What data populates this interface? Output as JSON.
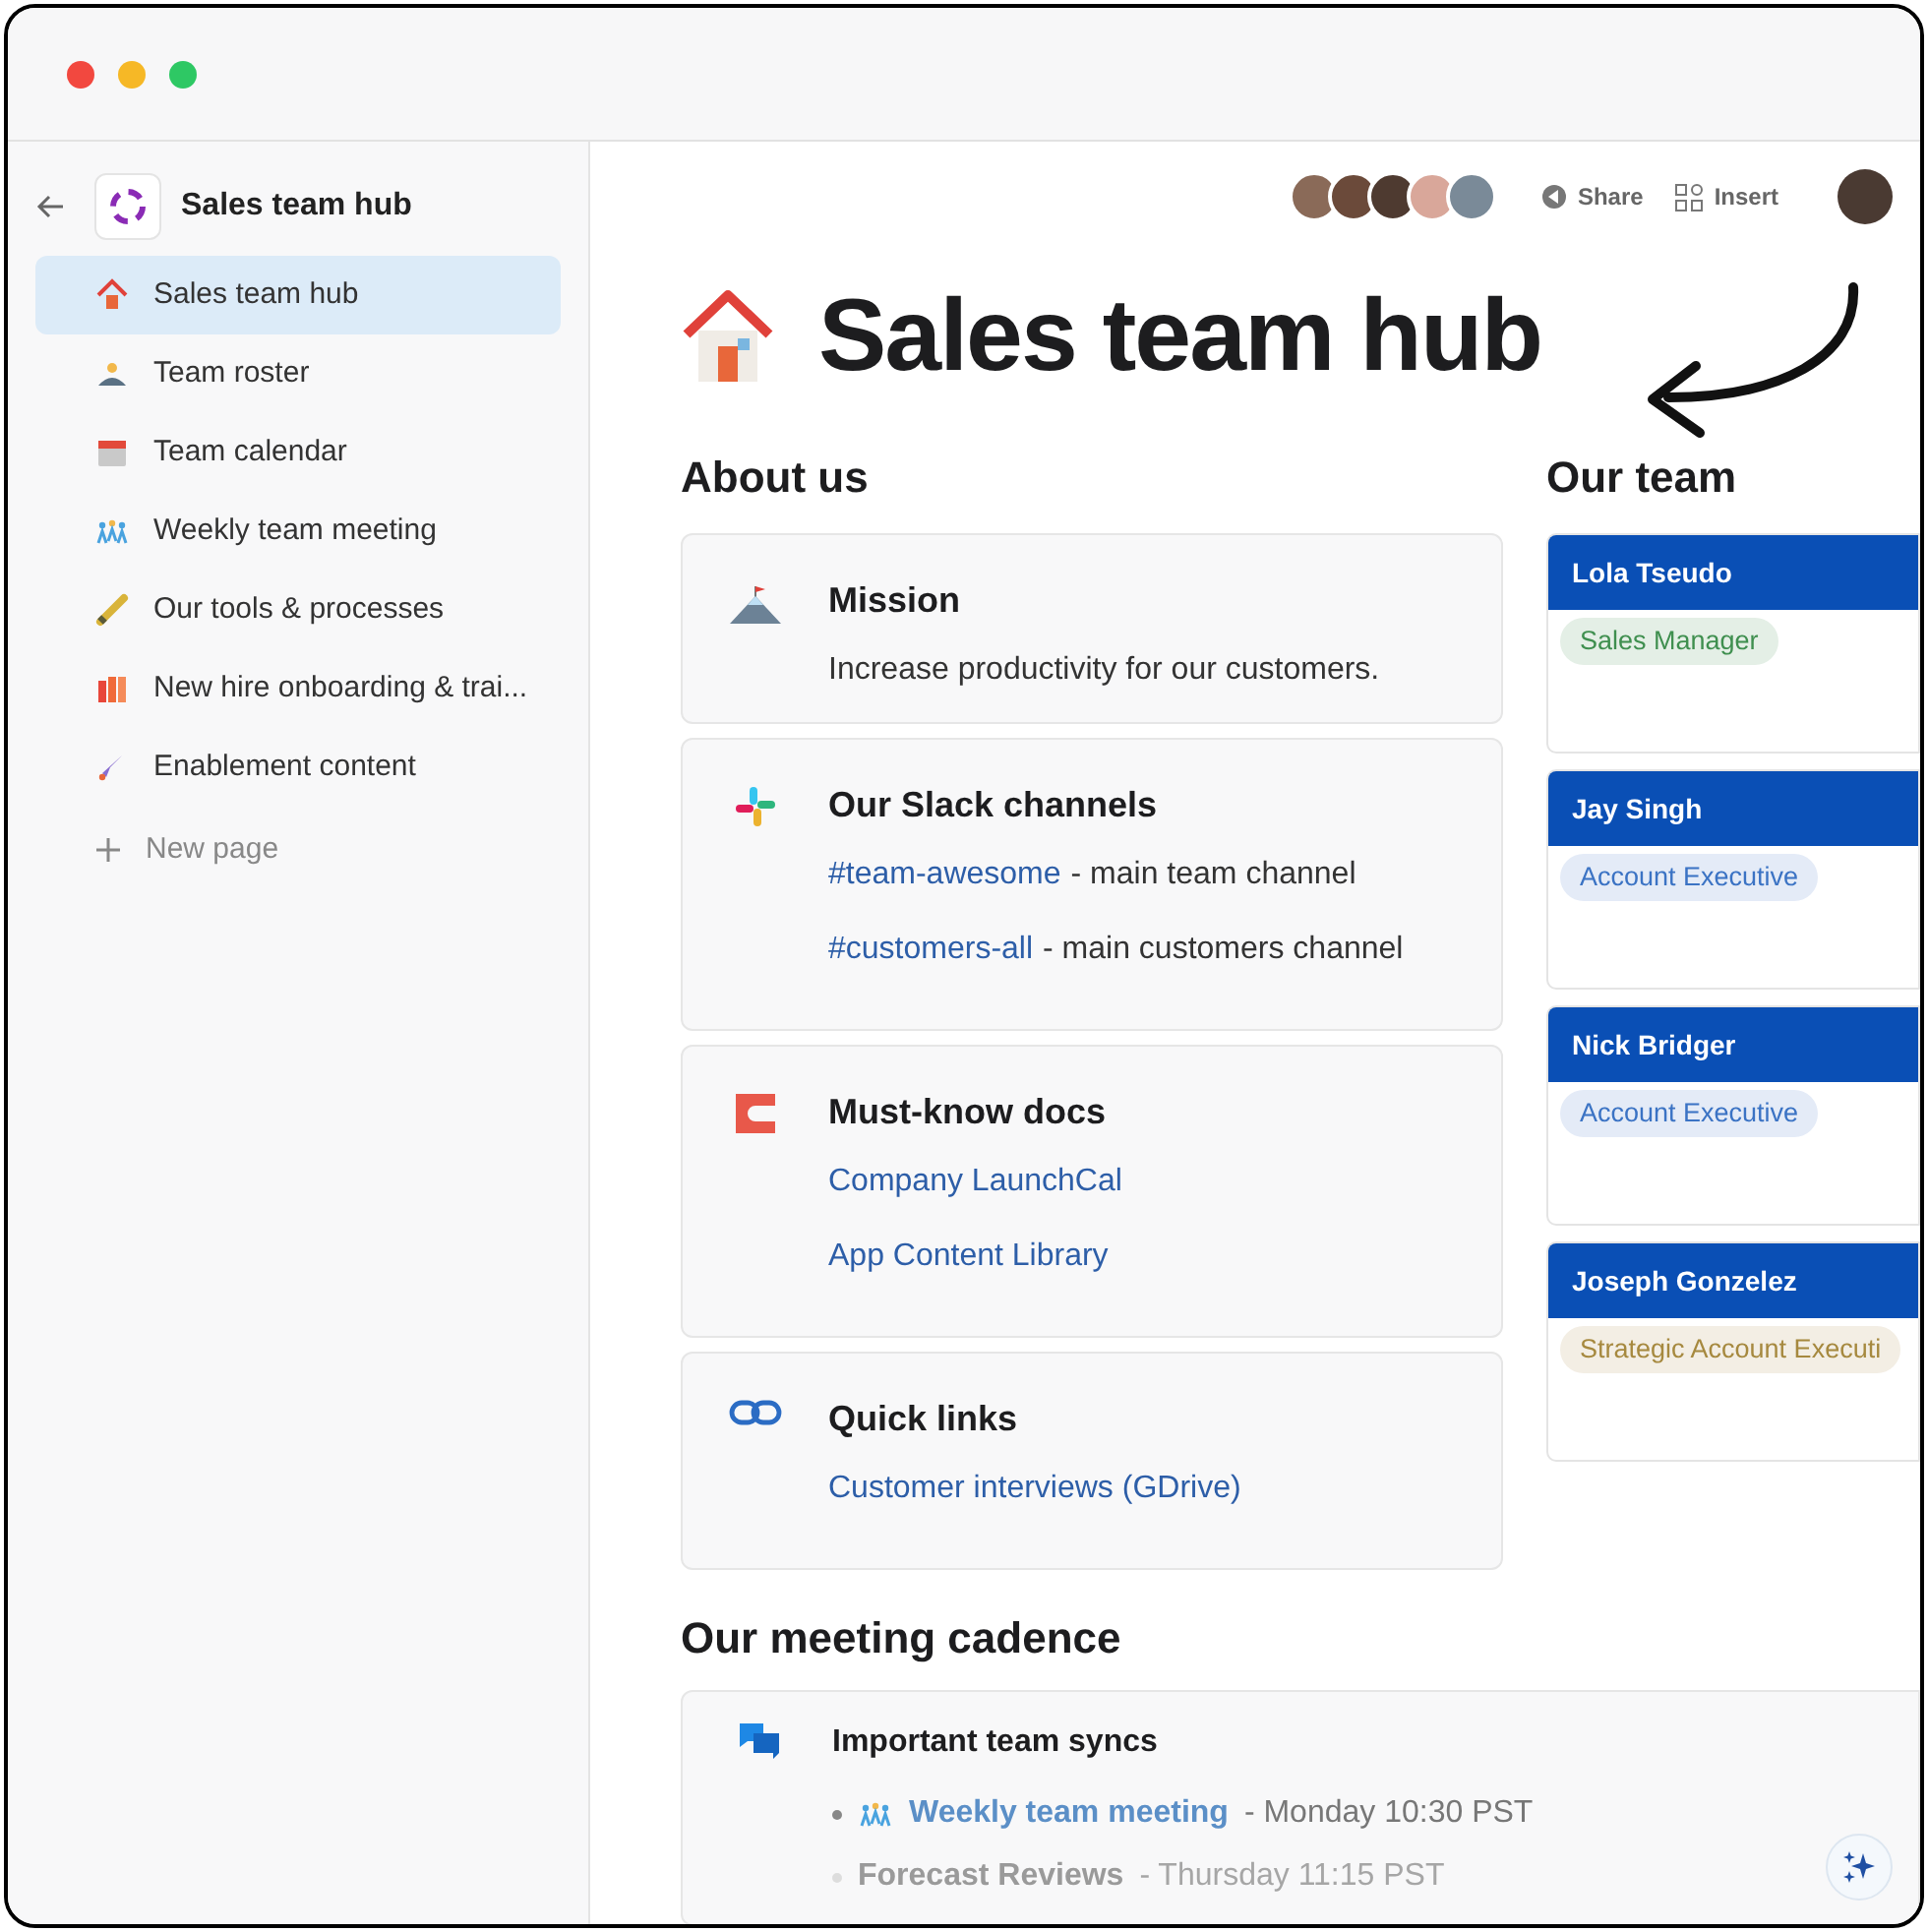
{
  "sidebar": {
    "title": "Sales team hub",
    "items": [
      {
        "label": "Sales team hub",
        "selected": true
      },
      {
        "label": "Team roster",
        "selected": false
      },
      {
        "label": "Team calendar",
        "selected": false
      },
      {
        "label": "Weekly team meeting",
        "selected": false
      },
      {
        "label": "Our tools & processes",
        "selected": false
      },
      {
        "label": "New hire onboarding & trai...",
        "selected": false
      },
      {
        "label": "Enablement content",
        "selected": false
      }
    ],
    "new_page": "New page"
  },
  "toolbar": {
    "share": "Share",
    "insert": "Insert"
  },
  "page": {
    "title": "Sales team hub",
    "about_heading": "About us",
    "cards": [
      {
        "kind": "text",
        "title": "Mission",
        "body": "Increase productivity for our customers."
      },
      {
        "kind": "links",
        "title": "Our Slack channels",
        "links": [
          {
            "link": "#team-awesome",
            "note": "- main team channel"
          },
          {
            "link": "#customers-all",
            "note": "- main customers channel"
          }
        ]
      },
      {
        "kind": "links",
        "title": "Must-know docs",
        "links": [
          {
            "link": "Company LaunchCal"
          },
          {
            "link": "App Content Library"
          }
        ]
      },
      {
        "kind": "links",
        "title": "Quick links",
        "links": [
          {
            "link": "Customer interviews (GDrive)"
          }
        ]
      }
    ],
    "team_heading": "Our team",
    "team": [
      {
        "name": "Lola Tseudo",
        "role": "Sales Manager",
        "color": "#3f8f4f"
      },
      {
        "name": "Jay Singh",
        "role": "Account Executive",
        "color": "#3b73c4"
      },
      {
        "name": "Nick Bridger",
        "role": "Account Executive",
        "color": "#3b73c4"
      },
      {
        "name": "Joseph Gonzelez",
        "role": "Strategic Account Executi",
        "color": "#a6893f"
      }
    ],
    "cadence_heading": "Our meeting cadence",
    "syncs": {
      "title": "Important team syncs",
      "items": [
        {
          "link": "Weekly team meeting",
          "detail": "- Monday 10:30 PST",
          "faded": false
        },
        {
          "link": "Forecast Reviews",
          "detail": "- Thursday 11:15 PST",
          "faded": true
        }
      ]
    }
  }
}
